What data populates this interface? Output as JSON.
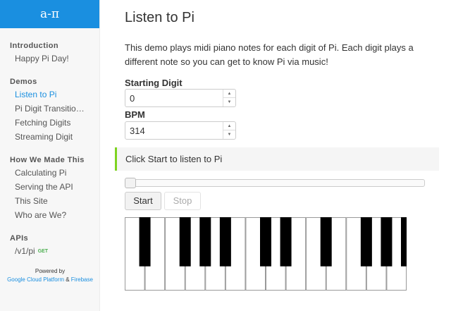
{
  "sidebar": {
    "brand": "a-π",
    "groups": [
      {
        "title": "Introduction",
        "items": [
          {
            "label": "Happy Pi Day!"
          }
        ]
      },
      {
        "title": "Demos",
        "items": [
          {
            "label": "Listen to Pi",
            "active": true
          },
          {
            "label": "Pi Digit Transitions ..."
          },
          {
            "label": "Fetching Digits"
          },
          {
            "label": "Streaming Digit"
          }
        ]
      },
      {
        "title": "How We Made This",
        "items": [
          {
            "label": "Calculating Pi"
          },
          {
            "label": "Serving the API"
          },
          {
            "label": "This Site"
          },
          {
            "label": "Who are We?"
          }
        ]
      },
      {
        "title": "APIs",
        "items": [
          {
            "label": "/v1/pi",
            "badge": "GET"
          }
        ]
      }
    ],
    "powered_by": "Powered by",
    "powered_link1": "Google Cloud Platform",
    "powered_amp": " & ",
    "powered_link2": "Firebase"
  },
  "main": {
    "title": "Listen to Pi",
    "description": "This demo plays midi piano notes for each digit of Pi. Each digit plays a different note so you can get to know Pi via music!",
    "starting_digit_label": "Starting Digit",
    "starting_digit_value": "0",
    "bpm_label": "BPM",
    "bpm_value": "314",
    "notice": "Click Start to listen to Pi",
    "progress": 0,
    "start_label": "Start",
    "stop_label": "Stop"
  },
  "piano": {
    "white_key_count": 14,
    "black_key_after_white": [
      0,
      2,
      3,
      4,
      6,
      7,
      9,
      11,
      12,
      13
    ],
    "white_color": "#ffffff",
    "black_color": "#000000"
  },
  "colors": {
    "accent": "#1a8fe0",
    "notice_bar": "#7ed321",
    "badge": "#4caf50"
  }
}
